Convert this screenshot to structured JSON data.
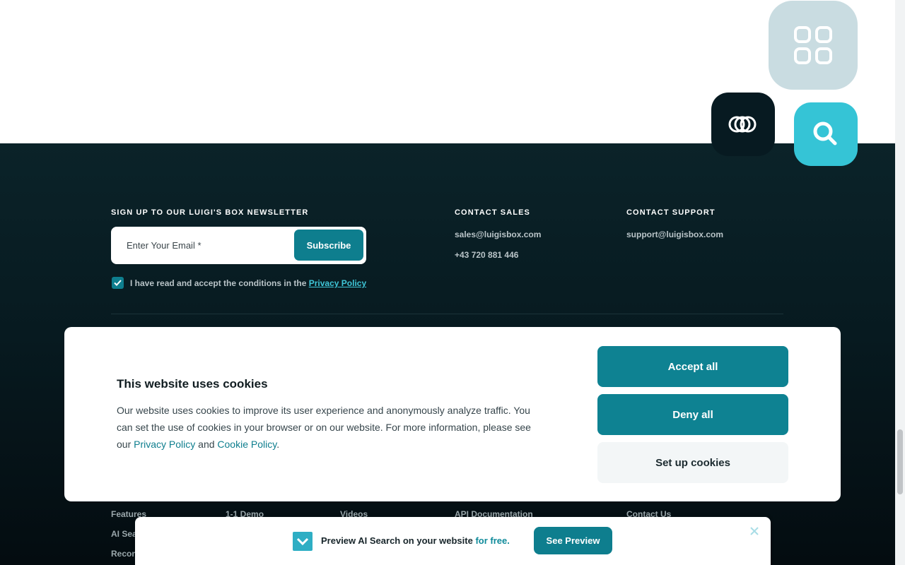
{
  "newsletter": {
    "heading": "SIGN UP TO OUR LUIGI'S BOX NEWSLETTER",
    "email_placeholder": "Enter Your Email *",
    "subscribe_label": "Subscribe",
    "consent_text": "I have read and accept the conditions in the ",
    "consent_link": "Privacy Policy",
    "checkbox_checked": true
  },
  "contact_sales": {
    "heading": "CONTACT SALES",
    "email": "sales@luigisbox.com",
    "phone": "+43 720 881 446"
  },
  "contact_support": {
    "heading": "CONTACT SUPPORT",
    "email": "support@luigisbox.com"
  },
  "footer_links": {
    "col1": [
      "Features",
      "AI Sea",
      "Recon"
    ],
    "col2": [
      "1-1 Demo"
    ],
    "col3": [
      "Videos"
    ],
    "col4": [
      "API Documentation"
    ],
    "col5": [
      "Contact Us"
    ]
  },
  "cookie_banner": {
    "title": "This website uses cookies",
    "body_1": "Our website uses cookies to improve its user experience and anonymously analyze traffic. You can set the use of cookies in your browser or on our website. For more information, please see our ",
    "privacy_link": "Privacy Policy",
    "body_and": " and ",
    "cookie_link": "Cookie Policy",
    "body_end": ".",
    "accept_label": "Accept all",
    "deny_label": "Deny all",
    "setup_label": "Set up cookies"
  },
  "promo_bar": {
    "text": "Preview AI Search on your website ",
    "highlight": "for free.",
    "button_label": "See Preview"
  },
  "icons": {
    "tile_grid": "grid-icon",
    "tile_rings": "rings-icon",
    "tile_search": "search-icon",
    "checkbox": "check-icon",
    "promo_logo": "chevron-down-icon",
    "promo_close": "close-icon"
  },
  "colors": {
    "accent": "#0e7e8e",
    "link": "#3fc6d8",
    "footer_bg": "#071a20",
    "tile_grid": "#c9dce1",
    "tile_search": "#35c4d6"
  }
}
